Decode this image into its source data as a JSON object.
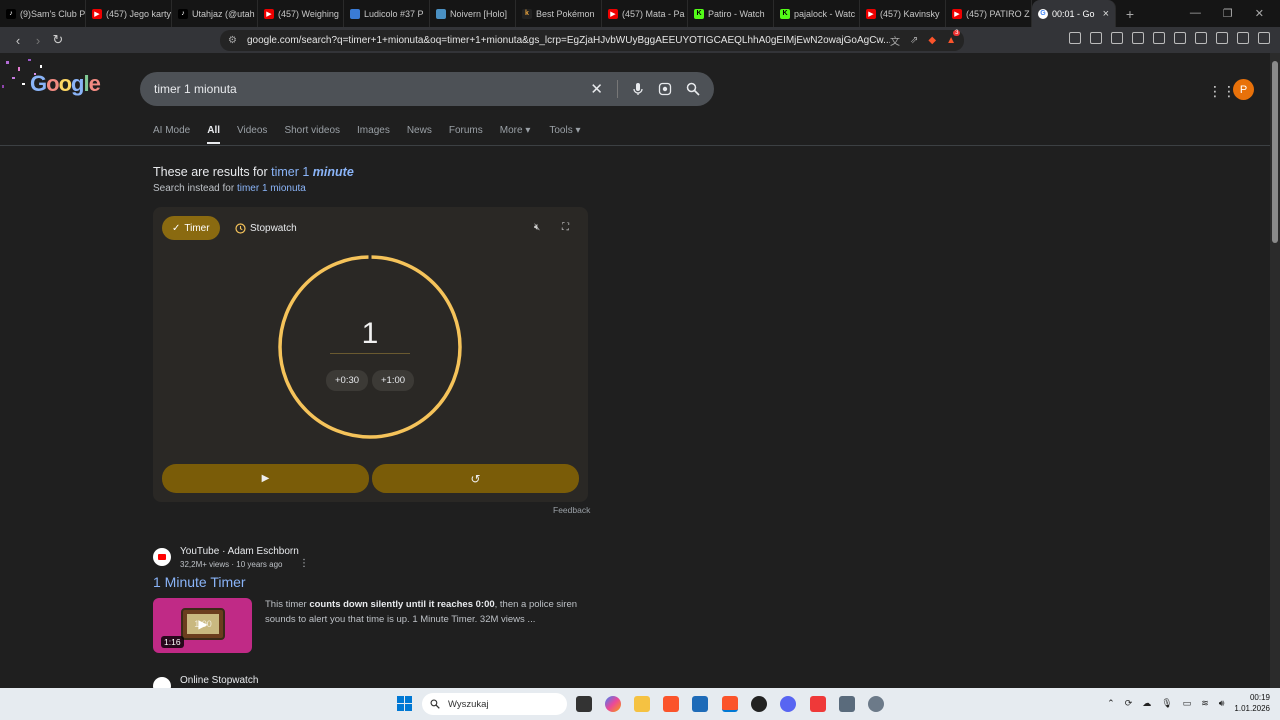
{
  "browser": {
    "tabs": [
      {
        "label": "(9)Sam's Club P",
        "icon": "tiktok-icon"
      },
      {
        "label": "(457) Jego karty",
        "icon": "youtube-icon"
      },
      {
        "label": "Utahjaz (@utah",
        "icon": "tiktok-icon"
      },
      {
        "label": "(457) Weighing",
        "icon": "youtube-icon"
      },
      {
        "label": "Ludicolo #37 P",
        "icon": "site-icon"
      },
      {
        "label": "Noivern [Holo]",
        "icon": "site-icon"
      },
      {
        "label": "Best Pokémon",
        "icon": "site-icon"
      },
      {
        "label": "(457) Mata - Pa",
        "icon": "youtube-icon"
      },
      {
        "label": "Patiro - Watch",
        "icon": "kick-icon"
      },
      {
        "label": "pajalock - Watc",
        "icon": "kick-icon"
      },
      {
        "label": "(457) Kavinsky",
        "icon": "youtube-icon"
      },
      {
        "label": "(457) PATIRO Z",
        "icon": "youtube-icon"
      },
      {
        "label": "00:01 - Go",
        "icon": "google-icon"
      }
    ],
    "url": "google.com/search?q=timer+1+mionuta&oq=timer+1+mionuta&gs_lcrp=EgZjaHJvbWUyBggAEEUYOTIGCAEQLhhA0gEIMjEwN2owajGoAgCw...",
    "brave_badge": "3"
  },
  "google": {
    "logo": [
      "G",
      "o",
      "o",
      "g",
      "l",
      "e"
    ],
    "query": "timer 1 mionuta",
    "avatar_letter": "P",
    "filters": [
      "AI Mode",
      "All",
      "Videos",
      "Short videos",
      "Images",
      "News",
      "Forums",
      "More",
      "Tools"
    ],
    "correction_prefix": "These are results for ",
    "correction_link": "timer 1",
    "correction_bold": "minute",
    "instead_prefix": "Search instead for ",
    "instead_link": "timer 1 mionuta"
  },
  "timer": {
    "mode_timer": "Timer",
    "mode_stopwatch": "Stopwatch",
    "display": "1",
    "add30": "+0:30",
    "add60": "+1:00",
    "feedback": "Feedback",
    "accent": "#f5c35a"
  },
  "result1": {
    "source": "YouTube · Adam Eschborn",
    "meta": "32,2M+ views · 10 years ago",
    "title": "1 Minute Timer",
    "duration": "1:16",
    "thumb_text": "1:00",
    "snippet_a": "This timer ",
    "snippet_b": "counts down silently until it reaches 0:00",
    "snippet_c": ", then a police siren sounds to alert you that time is up. 1 Minute Timer. 32M views ..."
  },
  "result2": {
    "source": "Online Stopwatch"
  },
  "taskbar": {
    "search_placeholder": "Wyszukaj",
    "time": "00:19",
    "date": "1.01.2026"
  }
}
